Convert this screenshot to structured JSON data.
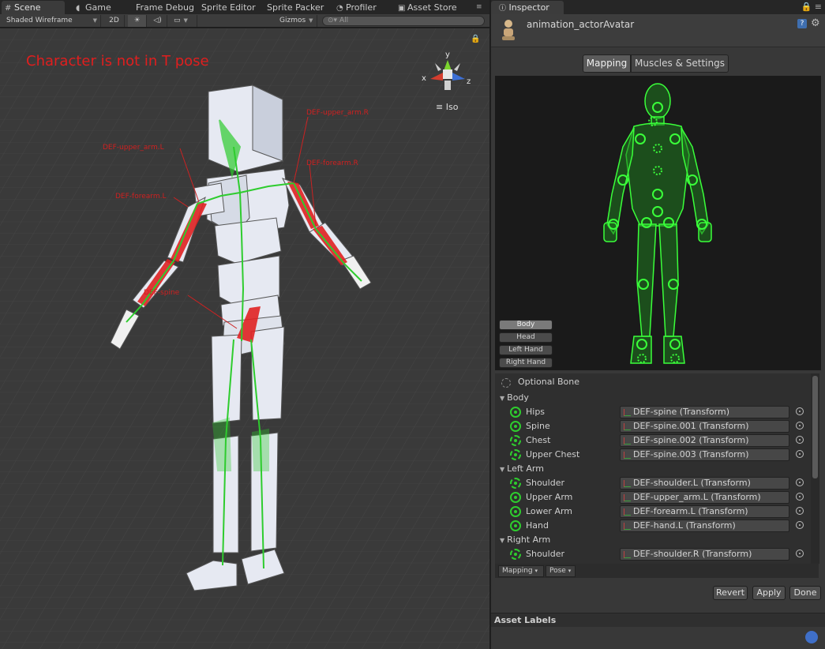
{
  "tabs": [
    {
      "label": "Scene",
      "icon": "grid-icon"
    },
    {
      "label": "Game",
      "icon": "pacman-icon"
    },
    {
      "label": "Frame Debug"
    },
    {
      "label": "Sprite Editor"
    },
    {
      "label": "Sprite Packer"
    },
    {
      "label": "Profiler",
      "icon": "profiler-icon"
    },
    {
      "label": "Asset Store",
      "icon": "store-icon"
    }
  ],
  "scene_toolbar": {
    "render_mode": "Shaded Wireframe",
    "mode_2d": "2D",
    "gizmos": "Gizmos",
    "search_placeholder": "All"
  },
  "scene": {
    "warning": "Character is not in T pose",
    "iso": "Iso",
    "gizmo_axes": {
      "x": "x",
      "y": "y",
      "z": "z"
    },
    "bone_labels": [
      "DEF-upper_arm.R",
      "DEF-upper_arm.L",
      "DEF-forearm.R",
      "DEF-forearm.L",
      "DEF-spine"
    ]
  },
  "inspector": {
    "tab": "Inspector",
    "asset_name": "animation_actorAvatar",
    "segments": [
      "Mapping",
      "Muscles & Settings"
    ],
    "body_parts": [
      "Body",
      "Head",
      "Left Hand",
      "Right Hand"
    ],
    "optional_bone": "Optional Bone",
    "groups": [
      {
        "name": "Body",
        "bones": [
          {
            "name": "Hips",
            "value": "DEF-spine (Transform)",
            "optional": false
          },
          {
            "name": "Spine",
            "value": "DEF-spine.001 (Transform)",
            "optional": false
          },
          {
            "name": "Chest",
            "value": "DEF-spine.002 (Transform)",
            "optional": true
          },
          {
            "name": "Upper Chest",
            "value": "DEF-spine.003 (Transform)",
            "optional": true
          }
        ]
      },
      {
        "name": "Left Arm",
        "bones": [
          {
            "name": "Shoulder",
            "value": "DEF-shoulder.L (Transform)",
            "optional": true
          },
          {
            "name": "Upper Arm",
            "value": "DEF-upper_arm.L (Transform)",
            "optional": false
          },
          {
            "name": "Lower Arm",
            "value": "DEF-forearm.L (Transform)",
            "optional": false
          },
          {
            "name": "Hand",
            "value": "DEF-hand.L (Transform)",
            "optional": false
          }
        ]
      },
      {
        "name": "Right Arm",
        "bones": [
          {
            "name": "Shoulder",
            "value": "DEF-shoulder.R (Transform)",
            "optional": true
          }
        ]
      }
    ],
    "bottom_tools": [
      "Mapping",
      "Pose"
    ],
    "actions": [
      "Revert",
      "Apply",
      "Done"
    ],
    "asset_labels": "Asset Labels"
  },
  "colors": {
    "bone_green": "#2ecc2e",
    "warning_red": "#e01e1e",
    "panel": "#383838",
    "viewport": "#3a3a3a"
  }
}
